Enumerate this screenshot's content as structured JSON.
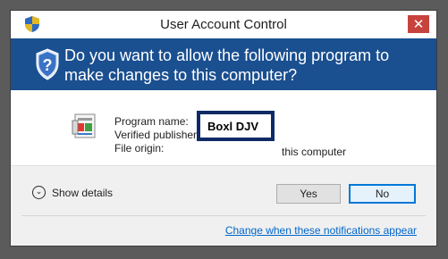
{
  "window": {
    "title": "User Account Control",
    "close_glyph": "✕"
  },
  "banner": {
    "question": "Do you want to allow the following program to make changes to this computer?"
  },
  "program": {
    "name_label": "Program name:",
    "publisher_label": "Verified publisher",
    "origin_label": "File origin:",
    "redaction_text": "Boxl DJV",
    "origin_value": "this computer"
  },
  "footer": {
    "details_label": "Show details",
    "details_glyph": "⌄",
    "yes_label": "Yes",
    "no_label": "No",
    "link_text": "Change when these notifications appear"
  },
  "icons": {
    "title": "uac-shield-icon",
    "banner": "uac-shield-icon",
    "program": "installer-icon",
    "details": "chevron-down-icon",
    "close": "close-icon"
  },
  "colors": {
    "banner": "#1a4f90",
    "close": "#c7433d",
    "redaction": "#0f2a66",
    "link": "#0066cc"
  }
}
